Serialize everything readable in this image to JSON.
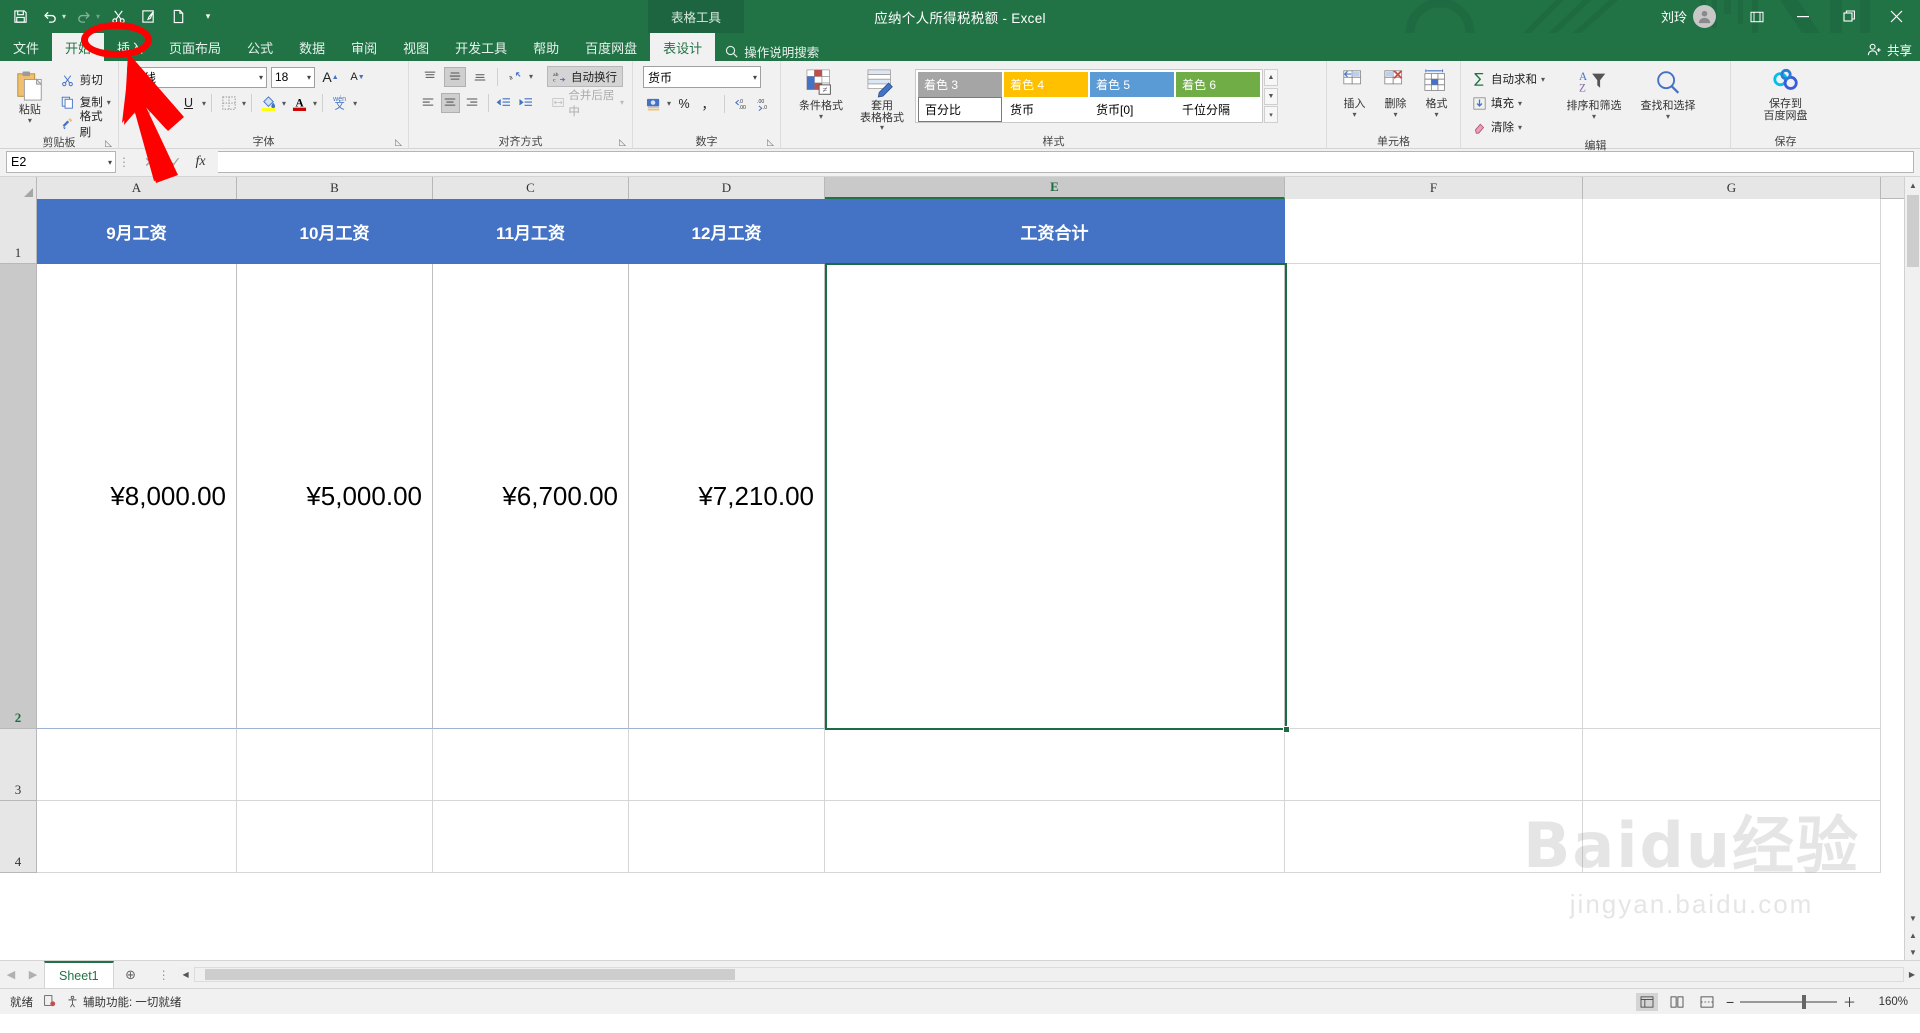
{
  "titlebar": {
    "document_title": "应纳个人所得税税额  -  Excel",
    "contextual_tab_group": "表格工具",
    "user_name": "刘玲",
    "qat": [
      {
        "name": "save",
        "glyph": "save-icon"
      },
      {
        "name": "undo",
        "glyph": "undo-icon"
      },
      {
        "name": "redo",
        "glyph": "redo-icon"
      },
      {
        "name": "cut",
        "glyph": "scissors-icon"
      },
      {
        "name": "quick-print",
        "glyph": "print-icon"
      },
      {
        "name": "new",
        "glyph": "page-icon"
      },
      {
        "name": "customize",
        "glyph": "chevron-down-icon"
      }
    ],
    "window_controls": {
      "ribbon_display": "⊞",
      "minimize": "—",
      "restore": "❐",
      "close": "✕"
    }
  },
  "tabs": {
    "items": [
      {
        "label": "文件",
        "active": false
      },
      {
        "label": "开始",
        "active": true
      },
      {
        "label": "插入",
        "active": false
      },
      {
        "label": "页面布局",
        "active": false
      },
      {
        "label": "公式",
        "active": false
      },
      {
        "label": "数据",
        "active": false
      },
      {
        "label": "审阅",
        "active": false
      },
      {
        "label": "视图",
        "active": false
      },
      {
        "label": "开发工具",
        "active": false
      },
      {
        "label": "帮助",
        "active": false
      },
      {
        "label": "百度网盘",
        "active": false
      },
      {
        "label": "表设计",
        "active": true
      }
    ],
    "tell_me": "操作说明搜索",
    "share": "共享"
  },
  "ribbon": {
    "clipboard": {
      "title": "剪贴板",
      "paste": "粘贴",
      "cut": "剪切",
      "copy": "复制",
      "format_painter": "格式刷"
    },
    "font": {
      "title": "字体",
      "font_name": "等线",
      "font_size": "18",
      "grow_font": "A",
      "shrink_font": "A",
      "bold": "B",
      "italic": "I",
      "underline": "U",
      "borders": "borders-icon",
      "fill_color": "fill-color-icon",
      "font_color": "font-color-icon",
      "phonetic": "wén 文"
    },
    "alignment": {
      "title": "对齐方式",
      "wrap_text": "自动换行",
      "merge_center": "合并后居中",
      "orientation": "orientation-icon"
    },
    "number": {
      "title": "数字",
      "format": "货币",
      "accounting": "accounting-icon",
      "percent": "%",
      "comma": "，",
      "increase_decimal": "←.0 .00",
      "decrease_decimal": ".00 →.0"
    },
    "styles": {
      "title": "样式",
      "conditional_format": "条件格式",
      "format_as_table": "套用\n表格格式",
      "gallery": [
        {
          "label": "着色 3",
          "bg": "#a5a5a5",
          "fg": "#ffffff",
          "selected": false
        },
        {
          "label": "着色 4",
          "bg": "#ffc000",
          "fg": "#ffffff",
          "selected": false
        },
        {
          "label": "着色 5",
          "bg": "#5b9bd5",
          "fg": "#ffffff",
          "selected": false
        },
        {
          "label": "着色 6",
          "bg": "#70ad47",
          "fg": "#ffffff",
          "selected": false
        },
        {
          "label": "百分比",
          "bg": "#ffffff",
          "fg": "#000000",
          "selected": true
        },
        {
          "label": "货币",
          "bg": "#ffffff",
          "fg": "#000000",
          "selected": false
        },
        {
          "label": "货币[0]",
          "bg": "#ffffff",
          "fg": "#000000",
          "selected": false
        },
        {
          "label": "千位分隔",
          "bg": "#ffffff",
          "fg": "#000000",
          "selected": false
        }
      ]
    },
    "cells": {
      "title": "单元格",
      "insert": "插入",
      "delete": "删除",
      "format": "格式"
    },
    "editing": {
      "title": "编辑",
      "autosum": "自动求和",
      "fill": "填充",
      "clear": "清除",
      "sort_filter": "排序和筛选",
      "find_select": "查找和选择"
    },
    "baidu": {
      "title": "保存",
      "save_to_netdisk": "保存到\n百度网盘"
    }
  },
  "formula_bar": {
    "name_box": "E2",
    "cancel": "✕",
    "enter": "✓",
    "insert_function": "fx",
    "formula_value": ""
  },
  "grid": {
    "column_headers": [
      "A",
      "B",
      "C",
      "D",
      "E",
      "F",
      "G"
    ],
    "selected_column": "E",
    "row_headers": [
      "1",
      "2",
      "3",
      "4"
    ],
    "selected_row": "2",
    "header_row": {
      "A": "9月工资",
      "B": "10月工资",
      "C": "11月工资",
      "D": "12月工资",
      "E": "工资合计",
      "bg": "#4472c4",
      "fg": "#ffffff"
    },
    "data_row": {
      "A": "¥8,000.00",
      "B": "¥5,000.00",
      "C": "¥6,700.00",
      "D": "¥7,210.00",
      "E": ""
    },
    "active_cell": "E2"
  },
  "watermark": {
    "main": "Baidu经验",
    "sub": "jingyan.baidu.com"
  },
  "sheet_tabs": {
    "prev": "◀",
    "next": "▶",
    "sheets": [
      "Sheet1"
    ],
    "active_sheet": "Sheet1",
    "add_sheet": "＋"
  },
  "status_bar": {
    "ready": "就绪",
    "accessibility": "辅助功能: 一切就绪",
    "views": [
      {
        "name": "normal",
        "active": true
      },
      {
        "name": "page-layout",
        "active": false
      },
      {
        "name": "page-break",
        "active": false
      }
    ],
    "zoom_out": "−",
    "zoom_in": "＋",
    "zoom_level": "160%"
  },
  "annotation": {
    "circle_target": "插入",
    "color": "#ff0000"
  }
}
